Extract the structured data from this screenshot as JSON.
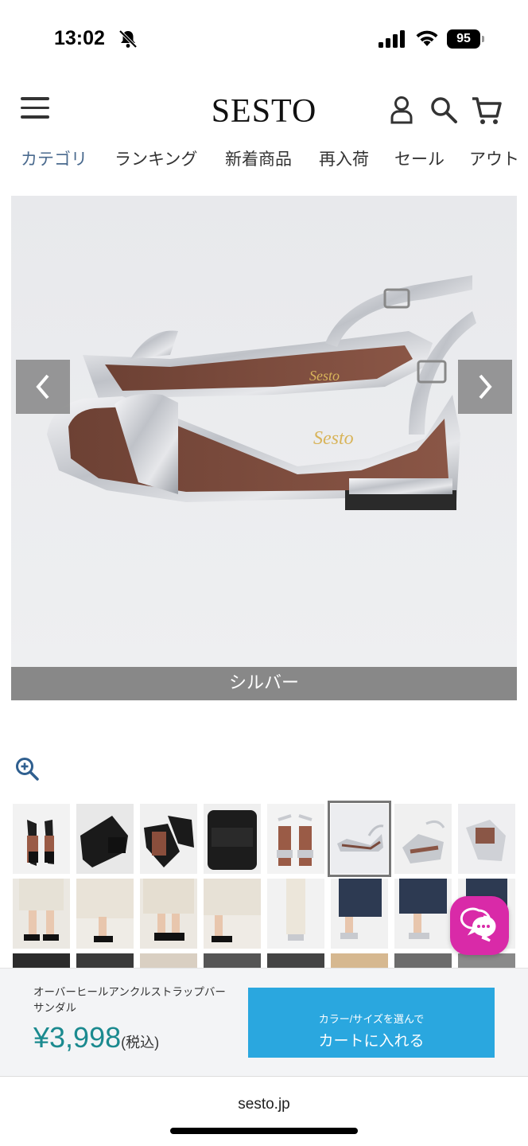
{
  "status": {
    "time": "13:02",
    "battery": "95"
  },
  "header": {
    "logo": "SESTO"
  },
  "nav": {
    "items": [
      {
        "label": "カテゴリ",
        "active": true
      },
      {
        "label": "ランキング",
        "active": false
      },
      {
        "label": "新着商品",
        "active": false
      },
      {
        "label": "再入荷",
        "active": false
      },
      {
        "label": "セール",
        "active": false
      },
      {
        "label": "アウト",
        "active": false
      }
    ]
  },
  "gallery": {
    "caption": "シルバー",
    "insole_text": "Sesto"
  },
  "thumbnails": {
    "selected_index": 5,
    "row1": [
      "black-sandal-front",
      "black-sandal-sole",
      "black-sandal-pair",
      "black-sandal-toe",
      "silver-sandal-front",
      "silver-sandal-side",
      "silver-sandal-angle",
      "silver-sandal-heel"
    ],
    "row2": [
      "model-black-1",
      "model-black-2",
      "model-black-3",
      "model-black-4",
      "model-silver-1",
      "model-silver-2",
      "model-silver-3",
      "model-silver-4"
    ]
  },
  "product": {
    "name": "オーバーヒールアンクルストラップバーサンダル",
    "price": "¥3,998",
    "tax_label": "(税込)"
  },
  "cart_button": {
    "sub_label": "カラー/サイズを選んで",
    "main_label": "カートに入れる"
  },
  "browser": {
    "url": "sesto.jp"
  },
  "colors": {
    "accent": "#2aa7df",
    "price": "#1b8a8f",
    "chat": "#d92aa8",
    "nav_active": "#4a6a8e"
  }
}
